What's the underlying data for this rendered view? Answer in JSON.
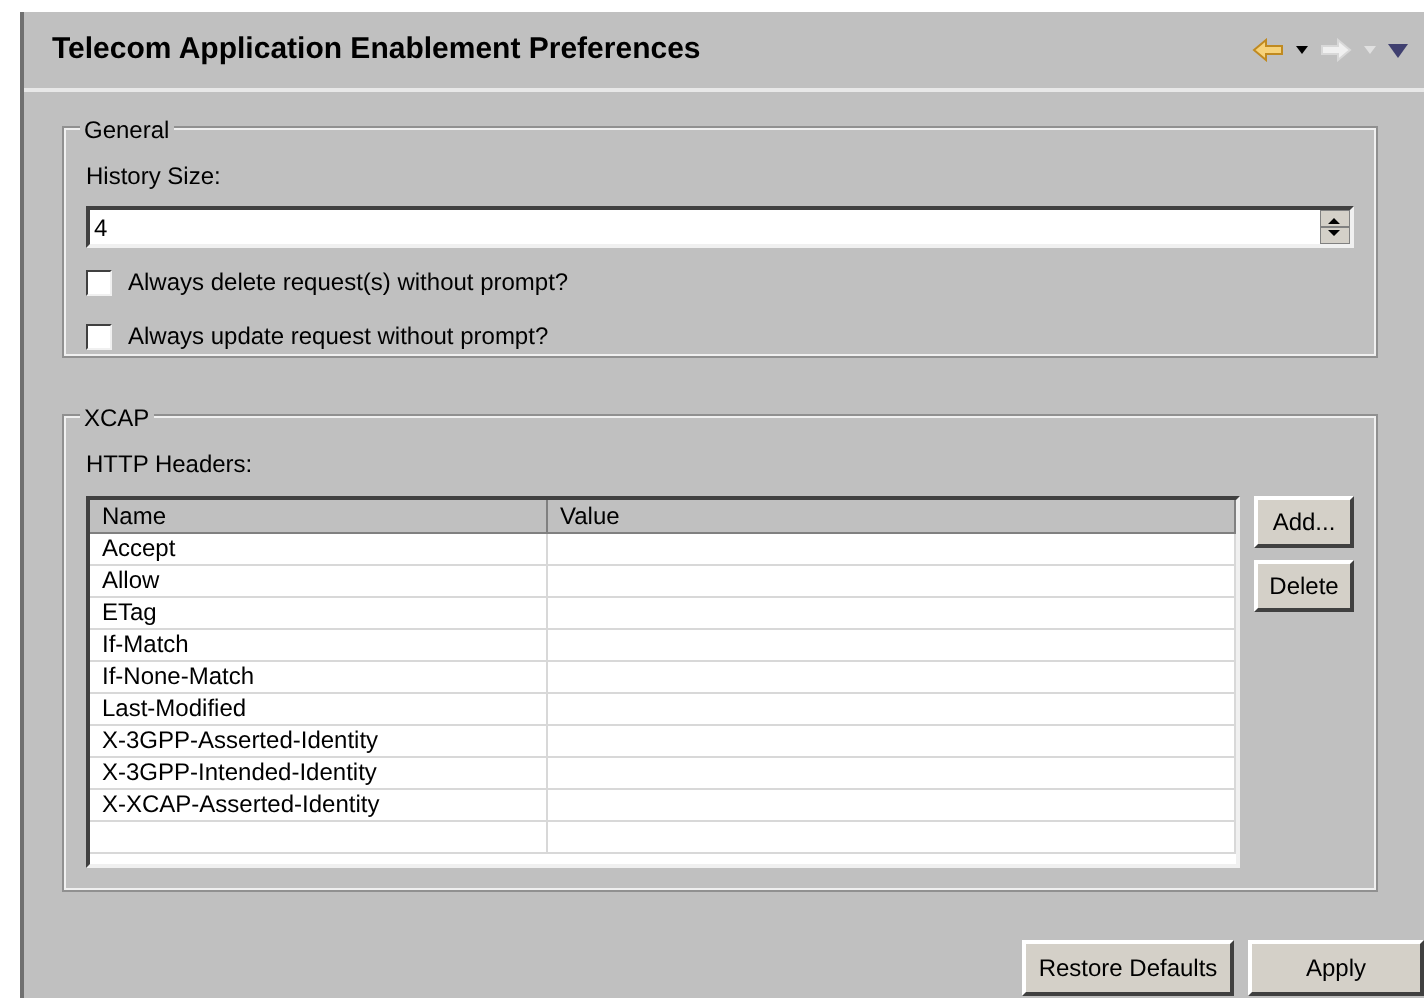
{
  "title": "Telecom Application Enablement Preferences",
  "general": {
    "legend": "General",
    "history_label": "History Size:",
    "history_value": "4",
    "checkboxes": [
      {
        "label": "Always delete request(s) without prompt?",
        "checked": false
      },
      {
        "label": "Always update request without prompt?",
        "checked": false
      }
    ]
  },
  "xcap": {
    "legend": "XCAP",
    "table_label": "HTTP Headers:",
    "columns": [
      "Name",
      "Value"
    ],
    "rows": [
      {
        "name": "Accept"
      },
      {
        "name": "Allow"
      },
      {
        "name": "ETag"
      },
      {
        "name": "If-Match"
      },
      {
        "name": "If-None-Match"
      },
      {
        "name": "Last-Modified"
      },
      {
        "name": "X-3GPP-Asserted-Identity"
      },
      {
        "name": "X-3GPP-Intended-Identity"
      },
      {
        "name": "X-XCAP-Asserted-Identity"
      }
    ],
    "buttons": [
      "Add...",
      "Delete"
    ]
  },
  "footer_buttons": [
    "Restore Defaults",
    "Apply"
  ]
}
